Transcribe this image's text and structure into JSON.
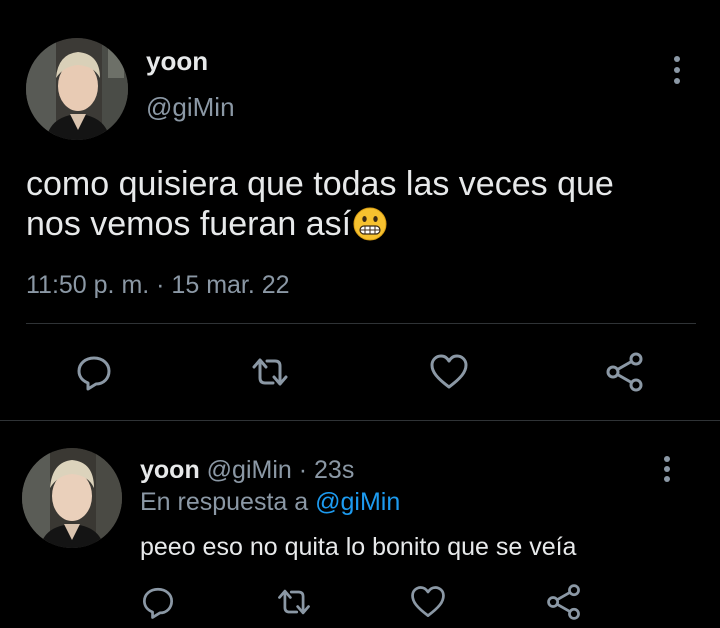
{
  "main_tweet": {
    "author_name": "yoon",
    "author_handle": "@giMin",
    "text_line1": "como quisiera que todas las veces que",
    "text_line2": "nos vemos fueran así",
    "emoji": "grimacing-face-emoji",
    "timestamp": "11:50 p. m. · 15 mar. 22",
    "actions": [
      "reply-icon",
      "retweet-icon",
      "like-icon",
      "share-icon"
    ]
  },
  "reply_tweet": {
    "author_name": "yoon",
    "author_handle": "@giMin",
    "separator": "·",
    "time_ago": "23s",
    "replying_to_prefix": "En respuesta a",
    "replying_to_handle": "@giMin",
    "text": "peeo eso no quita lo bonito que se veía",
    "actions": [
      "reply-icon",
      "retweet-icon",
      "like-icon",
      "share-icon"
    ]
  },
  "colors": {
    "background": "#000000",
    "text_primary": "#e7e9ea",
    "text_secondary": "#8b98a5",
    "accent": "#1d9bf0",
    "divider": "#2f3336"
  }
}
